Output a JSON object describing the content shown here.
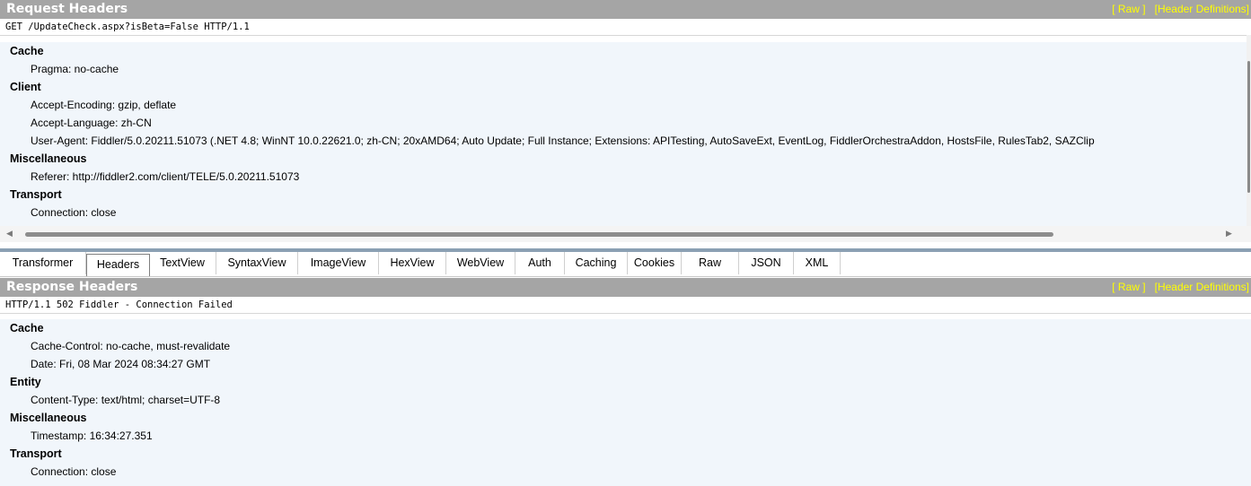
{
  "request": {
    "title": "Request Headers",
    "raw_link": "[ Raw ]",
    "defs_link": "[Header Definitions]",
    "request_line": "GET /UpdateCheck.aspx?isBeta=False HTTP/1.1",
    "groups": [
      {
        "name": "Cache",
        "items": [
          "Pragma: no-cache"
        ]
      },
      {
        "name": "Client",
        "items": [
          "Accept-Encoding: gzip, deflate",
          "Accept-Language: zh-CN",
          "User-Agent: Fiddler/5.0.20211.51073 (.NET 4.8; WinNT 10.0.22621.0; zh-CN; 20xAMD64; Auto Update; Full Instance; Extensions: APITesting, AutoSaveExt, EventLog, FiddlerOrchestraAddon, HostsFile, RulesTab2, SAZClip"
        ]
      },
      {
        "name": "Miscellaneous",
        "items": [
          "Referer: http://fiddler2.com/client/TELE/5.0.20211.51073"
        ]
      },
      {
        "name": "Transport",
        "items": [
          "Connection: close"
        ]
      }
    ]
  },
  "tabs": [
    "Transformer",
    "Headers",
    "TextView",
    "SyntaxView",
    "ImageView",
    "HexView",
    "WebView",
    "Auth",
    "Caching",
    "Cookies",
    "Raw",
    "JSON",
    "XML"
  ],
  "active_tab": "Headers",
  "response": {
    "title": "Response Headers",
    "raw_link": "[ Raw ]",
    "defs_link": "[Header Definitions]",
    "status_line": "HTTP/1.1 502 Fiddler - Connection Failed",
    "groups": [
      {
        "name": "Cache",
        "items": [
          "Cache-Control: no-cache, must-revalidate",
          "Date: Fri, 08 Mar 2024 08:34:27 GMT"
        ]
      },
      {
        "name": "Entity",
        "items": [
          "Content-Type: text/html; charset=UTF-8"
        ]
      },
      {
        "name": "Miscellaneous",
        "items": [
          "Timestamp: 16:34:27.351"
        ]
      },
      {
        "name": "Transport",
        "items": [
          "Connection: close"
        ]
      }
    ]
  },
  "colors": {
    "title_bar": "#a5a5a5",
    "link": "#ffff00",
    "tree_bg": "#f1f6fb",
    "splitter": "#8ba0b3"
  },
  "icons": {
    "scroll_left": "triangle-left-icon",
    "scroll_right": "triangle-right-icon"
  }
}
